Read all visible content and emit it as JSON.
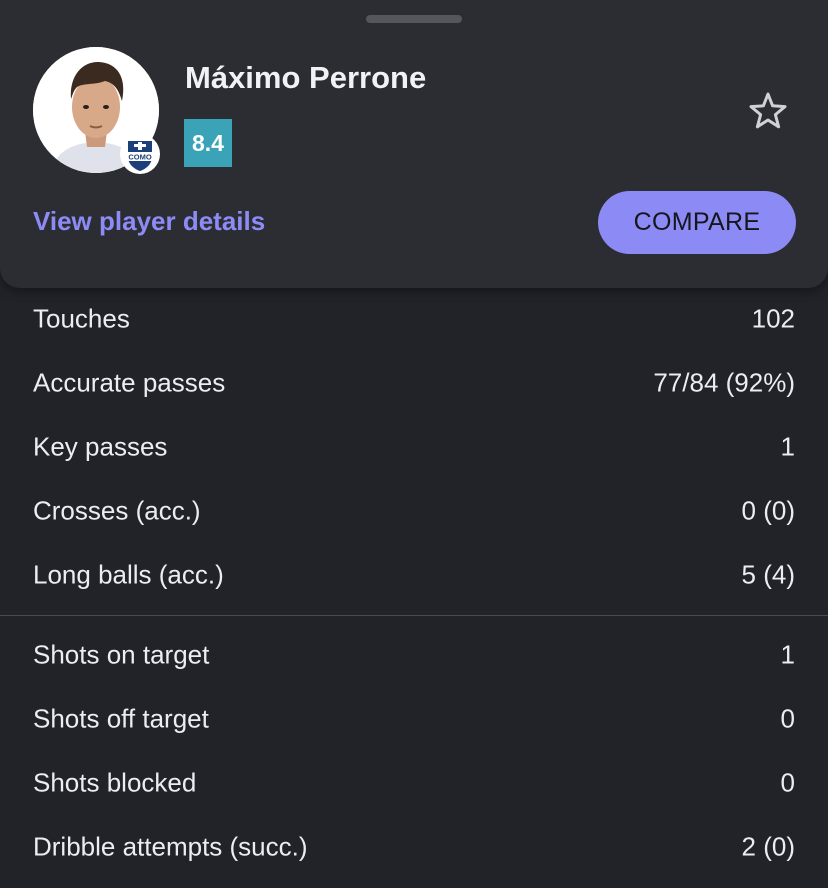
{
  "player": {
    "name": "Máximo Perrone",
    "rating": "8.4",
    "rating_color": "#3aa3b8",
    "photo_icon": "player-photo",
    "club_icon": "club-crest-icon",
    "club_badge_text": "COMO"
  },
  "actions": {
    "details_label": "View player details",
    "compare_label": "COMPARE",
    "favorite_icon": "star-outline-icon",
    "accent_color": "#8c8af5"
  },
  "sections": [
    {
      "stats": [
        {
          "label": "Touches",
          "value": "102"
        },
        {
          "label": "Accurate passes",
          "value": "77/84 (92%)"
        },
        {
          "label": "Key passes",
          "value": "1"
        },
        {
          "label": "Crosses (acc.)",
          "value": "0 (0)"
        },
        {
          "label": "Long balls (acc.)",
          "value": "5 (4)"
        }
      ]
    },
    {
      "stats": [
        {
          "label": "Shots on target",
          "value": "1"
        },
        {
          "label": "Shots off target",
          "value": "0"
        },
        {
          "label": "Shots blocked",
          "value": "0"
        },
        {
          "label": "Dribble attempts (succ.)",
          "value": "2 (0)"
        }
      ]
    }
  ]
}
